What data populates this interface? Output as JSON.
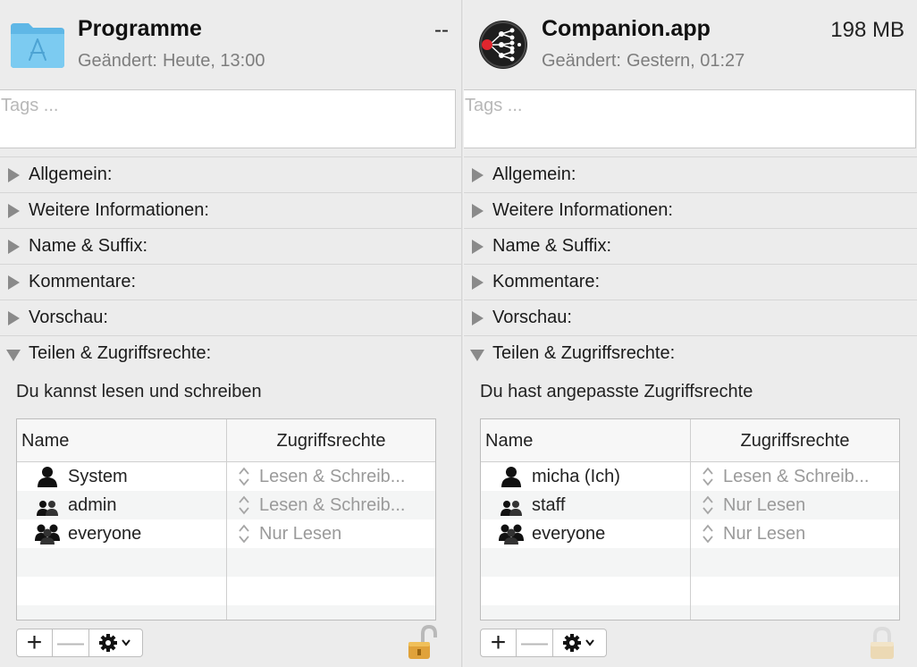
{
  "left": {
    "title": "Programme",
    "size": "--",
    "modified_label": "Geändert:",
    "modified_value": "Heute, 13:00",
    "icon": "applications-folder-icon",
    "tags_placeholder": "Tags ...",
    "sections": [
      {
        "label": "Allgemein:",
        "expanded": false
      },
      {
        "label": "Weitere Informationen:",
        "expanded": false
      },
      {
        "label": "Name & Suffix:",
        "expanded": false
      },
      {
        "label": "Kommentare:",
        "expanded": false
      },
      {
        "label": "Vorschau:",
        "expanded": false
      },
      {
        "label": "Teilen & Zugriffsrechte:",
        "expanded": true
      }
    ],
    "access_status": "Du kannst lesen und schreiben",
    "table": {
      "col_name": "Name",
      "col_access": "Zugriffsrechte",
      "rows": [
        {
          "name": "System",
          "access": "Lesen & Schreib...",
          "icon": "single-user-icon"
        },
        {
          "name": "admin",
          "access": "Lesen & Schreib...",
          "icon": "group-icon"
        },
        {
          "name": "everyone",
          "access": "Nur Lesen",
          "icon": "everyone-icon"
        }
      ]
    },
    "toolbar": {
      "add": "+",
      "remove": "—"
    },
    "lock_state": "unlocked"
  },
  "right": {
    "title": "Companion.app",
    "size": "198 MB",
    "modified_label": "Geändert:",
    "modified_value": "Gestern, 01:27",
    "icon": "companion-app-icon",
    "tags_placeholder": "Tags ...",
    "sections": [
      {
        "label": "Allgemein:",
        "expanded": false
      },
      {
        "label": "Weitere Informationen:",
        "expanded": false
      },
      {
        "label": "Name & Suffix:",
        "expanded": false
      },
      {
        "label": "Kommentare:",
        "expanded": false
      },
      {
        "label": "Vorschau:",
        "expanded": false
      },
      {
        "label": "Teilen & Zugriffsrechte:",
        "expanded": true
      }
    ],
    "access_status": "Du hast angepasste Zugriffsrechte",
    "table": {
      "col_name": "Name",
      "col_access": "Zugriffsrechte",
      "rows": [
        {
          "name": "micha (Ich)",
          "access": "Lesen & Schreib...",
          "icon": "single-user-icon"
        },
        {
          "name": "staff",
          "access": "Nur Lesen",
          "icon": "group-icon"
        },
        {
          "name": "everyone",
          "access": "Nur Lesen",
          "icon": "everyone-icon"
        }
      ]
    },
    "toolbar": {
      "add": "+",
      "remove": "—"
    },
    "lock_state": "locked-disabled"
  },
  "colors": {
    "folder_blue": "#6cc3ee",
    "lock_gold": "#e0a23a",
    "muted_text": "#9a9a9a"
  }
}
